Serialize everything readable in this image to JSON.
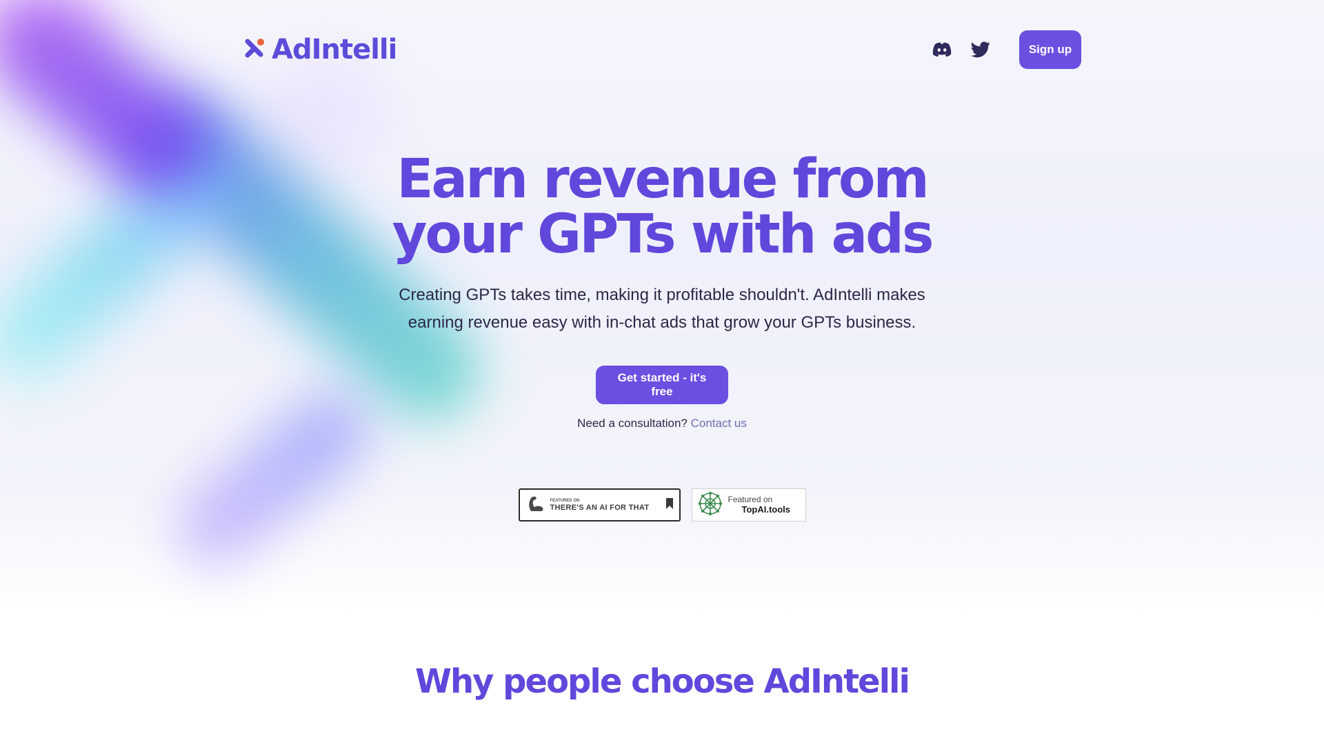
{
  "brand": {
    "name": "AdIntelli",
    "logo_icon": "adintelli-logo-icon",
    "colors": {
      "primary": "#6b4fe0",
      "heading": "#6147db",
      "accent_orange": "#e8663d"
    }
  },
  "header": {
    "social": [
      {
        "icon": "discord-icon"
      },
      {
        "icon": "twitter-icon"
      }
    ],
    "signup_label": "Sign up"
  },
  "hero": {
    "title": "Earn revenue from your GPTs with ads",
    "subtitle": "Creating GPTs takes time, making it profitable shouldn't. AdIntelli makes earning revenue easy with in-chat ads that grow your GPTs business.",
    "cta_label": "Get started - it's free",
    "consult_text": "Need a consultation?",
    "contact_label": "Contact us"
  },
  "badges": {
    "aift": {
      "small": "FEATURED ON",
      "big": "THERE'S AN AI FOR THAT"
    },
    "topai": {
      "small": "Featured on",
      "big": "TopAI.tools"
    }
  },
  "section": {
    "why_title": "Why people choose AdIntelli"
  }
}
